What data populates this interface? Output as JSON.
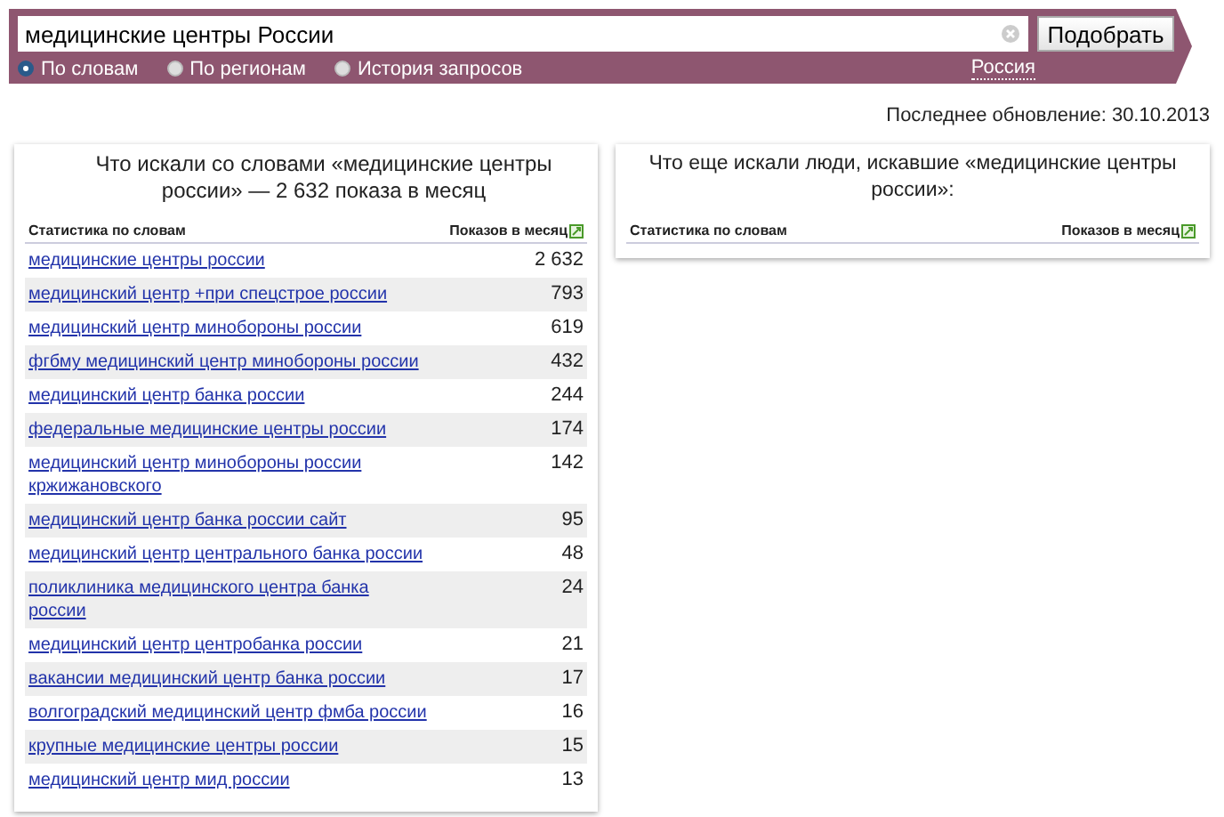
{
  "search": {
    "value": "медицинские центры России",
    "button": "Подобрать"
  },
  "modes": [
    {
      "label": "По словам",
      "selected": true
    },
    {
      "label": "По регионам",
      "selected": false
    },
    {
      "label": "История запросов",
      "selected": false
    }
  ],
  "region": "Россия",
  "last_update": "Последнее обновление: 30.10.2013",
  "left_panel": {
    "title": "Что искали со словами «медицинские центры\nроссии» — 2 632 показа в месяц",
    "columns": [
      "Статистика по словам",
      "Показов в месяц"
    ],
    "rows": [
      {
        "phrase": "медицинские центры россии",
        "count": "2 632"
      },
      {
        "phrase": "медицинский центр +при спецстрое россии",
        "count": "793"
      },
      {
        "phrase": "медицинский центр минобороны россии",
        "count": "619"
      },
      {
        "phrase": "фгбму медицинский центр минобороны россии",
        "count": "432"
      },
      {
        "phrase": "медицинский центр банка россии",
        "count": "244"
      },
      {
        "phrase": "федеральные медицинские центры россии",
        "count": "174"
      },
      {
        "phrase": "медицинский центр минобороны россии\nкржижановского",
        "count": "142"
      },
      {
        "phrase": "медицинский центр банка россии сайт",
        "count": "95"
      },
      {
        "phrase": "медицинский центр центрального банка россии",
        "count": "48"
      },
      {
        "phrase": "поликлиника медицинского центра банка\nроссии",
        "count": "24"
      },
      {
        "phrase": "медицинский центр центробанка россии",
        "count": "21"
      },
      {
        "phrase": "вакансии медицинский центр банка россии",
        "count": "17"
      },
      {
        "phrase": "волгоградский медицинский центр фмба россии",
        "count": "16"
      },
      {
        "phrase": "крупные медицинские центры россии",
        "count": "15"
      },
      {
        "phrase": "медицинский центр мид россии",
        "count": "13"
      }
    ]
  },
  "right_panel": {
    "title": "Что еще искали люди, искавшие «медицинские центры\nроссии»:",
    "columns": [
      "Статистика по словам",
      "Показов в месяц"
    ]
  }
}
